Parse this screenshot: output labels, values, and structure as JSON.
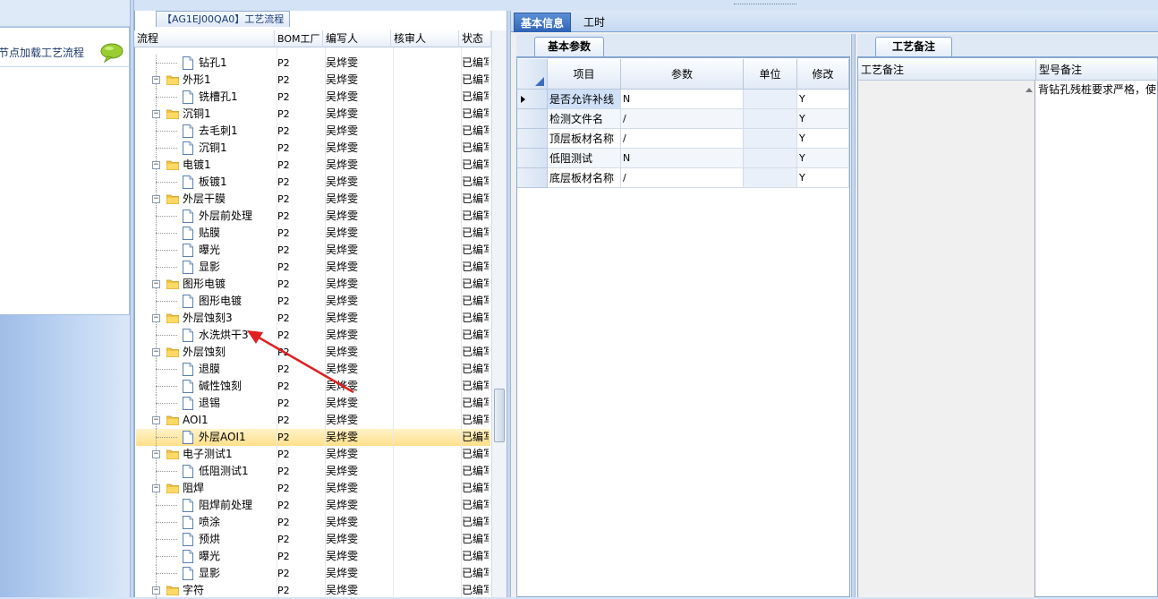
{
  "left_panel": {
    "title": "节点加载工艺流程",
    "icon": "chat-bubble-icon"
  },
  "tree": {
    "title_tab": "【AG1EJ00QA0】工艺流程",
    "columns": [
      "流程",
      "BOM工厂",
      "编写人",
      "核审人",
      "状态"
    ],
    "rows": [
      {
        "level": 1,
        "type": "doc",
        "name": "钻孔1",
        "bom": "P2",
        "writer": "吴烨雯",
        "reviewer": "",
        "status": "已编写"
      },
      {
        "level": 0,
        "type": "folder",
        "name": "外形1",
        "bom": "P2",
        "writer": "吴烨雯",
        "reviewer": "",
        "status": "已编写"
      },
      {
        "level": 1,
        "type": "doc",
        "name": "铣槽孔1",
        "bom": "P2",
        "writer": "吴烨雯",
        "reviewer": "",
        "status": "已编写"
      },
      {
        "level": 0,
        "type": "folder",
        "name": "沉铜1",
        "bom": "P2",
        "writer": "吴烨雯",
        "reviewer": "",
        "status": "已编写"
      },
      {
        "level": 1,
        "type": "doc",
        "name": "去毛刺1",
        "bom": "P2",
        "writer": "吴烨雯",
        "reviewer": "",
        "status": "已编写"
      },
      {
        "level": 1,
        "type": "doc",
        "name": "沉铜1",
        "bom": "P2",
        "writer": "吴烨雯",
        "reviewer": "",
        "status": "已编写"
      },
      {
        "level": 0,
        "type": "folder",
        "name": "电镀1",
        "bom": "P2",
        "writer": "吴烨雯",
        "reviewer": "",
        "status": "已编写"
      },
      {
        "level": 1,
        "type": "doc",
        "name": "板镀1",
        "bom": "P2",
        "writer": "吴烨雯",
        "reviewer": "",
        "status": "已编写"
      },
      {
        "level": 0,
        "type": "folder",
        "name": "外层干膜",
        "bom": "P2",
        "writer": "吴烨雯",
        "reviewer": "",
        "status": "已编写"
      },
      {
        "level": 1,
        "type": "doc",
        "name": "外层前处理",
        "bom": "P2",
        "writer": "吴烨雯",
        "reviewer": "",
        "status": "已编写"
      },
      {
        "level": 1,
        "type": "doc",
        "name": "贴膜",
        "bom": "P2",
        "writer": "吴烨雯",
        "reviewer": "",
        "status": "已编写"
      },
      {
        "level": 1,
        "type": "doc",
        "name": "曝光",
        "bom": "P2",
        "writer": "吴烨雯",
        "reviewer": "",
        "status": "已编写"
      },
      {
        "level": 1,
        "type": "doc",
        "name": "显影",
        "bom": "P2",
        "writer": "吴烨雯",
        "reviewer": "",
        "status": "已编写"
      },
      {
        "level": 0,
        "type": "folder",
        "name": "图形电镀",
        "bom": "P2",
        "writer": "吴烨雯",
        "reviewer": "",
        "status": "已编写"
      },
      {
        "level": 1,
        "type": "doc",
        "name": "图形电镀",
        "bom": "P2",
        "writer": "吴烨雯",
        "reviewer": "",
        "status": "已编写"
      },
      {
        "level": 0,
        "type": "folder",
        "name": "外层蚀刻3",
        "bom": "P2",
        "writer": "吴烨雯",
        "reviewer": "",
        "status": "已编写"
      },
      {
        "level": 1,
        "type": "doc",
        "name": "水洗烘干3",
        "bom": "P2",
        "writer": "吴烨雯",
        "reviewer": "",
        "status": "已编写"
      },
      {
        "level": 0,
        "type": "folder",
        "name": "外层蚀刻",
        "bom": "P2",
        "writer": "吴烨雯",
        "reviewer": "",
        "status": "已编写"
      },
      {
        "level": 1,
        "type": "doc",
        "name": "退膜",
        "bom": "P2",
        "writer": "吴烨雯",
        "reviewer": "",
        "status": "已编写"
      },
      {
        "level": 1,
        "type": "doc",
        "name": "碱性蚀刻",
        "bom": "P2",
        "writer": "吴烨雯",
        "reviewer": "",
        "status": "已编写"
      },
      {
        "level": 1,
        "type": "doc",
        "name": "退锡",
        "bom": "P2",
        "writer": "吴烨雯",
        "reviewer": "",
        "status": "已编写"
      },
      {
        "level": 0,
        "type": "folder",
        "name": "AOI1",
        "bom": "P2",
        "writer": "吴烨雯",
        "reviewer": "",
        "status": "已编写"
      },
      {
        "level": 1,
        "type": "doc",
        "name": "外层AOI1",
        "bom": "P2",
        "writer": "吴烨雯",
        "reviewer": "",
        "status": "已编写",
        "selected": true
      },
      {
        "level": 0,
        "type": "folder",
        "name": "电子测试1",
        "bom": "P2",
        "writer": "吴烨雯",
        "reviewer": "",
        "status": "已编写"
      },
      {
        "level": 1,
        "type": "doc",
        "name": "低阻测试1",
        "bom": "P2",
        "writer": "吴烨雯",
        "reviewer": "",
        "status": "已编写"
      },
      {
        "level": 0,
        "type": "folder",
        "name": "阻焊",
        "bom": "P2",
        "writer": "吴烨雯",
        "reviewer": "",
        "status": "已编写"
      },
      {
        "level": 1,
        "type": "doc",
        "name": "阻焊前处理",
        "bom": "P2",
        "writer": "吴烨雯",
        "reviewer": "",
        "status": "已编写"
      },
      {
        "level": 1,
        "type": "doc",
        "name": "喷涂",
        "bom": "P2",
        "writer": "吴烨雯",
        "reviewer": "",
        "status": "已编写"
      },
      {
        "level": 1,
        "type": "doc",
        "name": "预烘",
        "bom": "P2",
        "writer": "吴烨雯",
        "reviewer": "",
        "status": "已编写"
      },
      {
        "level": 1,
        "type": "doc",
        "name": "曝光",
        "bom": "P2",
        "writer": "吴烨雯",
        "reviewer": "",
        "status": "已编写"
      },
      {
        "level": 1,
        "type": "doc",
        "name": "显影",
        "bom": "P2",
        "writer": "吴烨雯",
        "reviewer": "",
        "status": "已编写"
      },
      {
        "level": 0,
        "type": "folder",
        "name": "字符",
        "bom": "P2",
        "writer": "吴烨雯",
        "reviewer": "",
        "status": "已编写"
      }
    ]
  },
  "tabs": {
    "top": [
      "基本信息",
      "工时"
    ],
    "active_top": "基本信息",
    "param_subtab": "基本参数",
    "remark_subtab": "工艺备注"
  },
  "param_grid": {
    "columns": [
      "项目",
      "参数",
      "单位",
      "修改"
    ],
    "rows": [
      {
        "item": "是否允许补线",
        "param": "N",
        "unit": "",
        "modify": "Y",
        "current": true
      },
      {
        "item": "检测文件名",
        "param": "/",
        "unit": "",
        "modify": "Y"
      },
      {
        "item": "顶层板材名称",
        "param": "/",
        "unit": "",
        "modify": "Y"
      },
      {
        "item": "低阻测试",
        "param": "N",
        "unit": "",
        "modify": "Y"
      },
      {
        "item": "底层板材名称",
        "param": "/",
        "unit": "",
        "modify": "Y"
      }
    ]
  },
  "remarks": {
    "columns": [
      "工艺备注",
      "型号备注"
    ],
    "model_remark_text": "背钻孔残桩要求严格，使"
  },
  "colors": {
    "accent_blue": "#2f63b5",
    "selected_row": "#ffe08a",
    "annotation_arrow": "#e02020"
  }
}
